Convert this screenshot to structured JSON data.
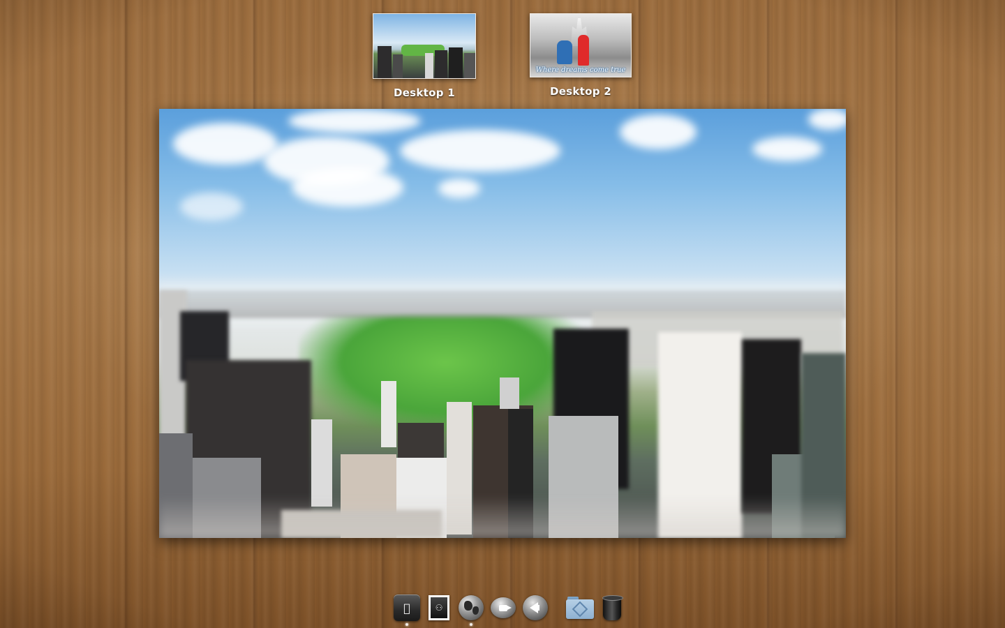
{
  "spaces": [
    {
      "label": "Desktop 1"
    },
    {
      "label": "Desktop 2",
      "caption": "Where dreams come true"
    }
  ],
  "preview": {
    "wallpaper": "city-park-tilt-shift"
  },
  "dock": {
    "items": [
      {
        "icon": "apple-icon",
        "running": true
      },
      {
        "icon": "photo-stamp-icon",
        "running": false
      },
      {
        "icon": "globe-icon",
        "running": true
      },
      {
        "icon": "facetime-icon",
        "running": false
      },
      {
        "icon": "speaker-icon",
        "running": false
      },
      {
        "icon": "folder-icon",
        "running": false
      },
      {
        "icon": "trash-icon",
        "running": false
      }
    ]
  },
  "colors": {
    "wood": "#a87a4a",
    "label": "#ffffff",
    "sky": "#5b9fdc",
    "park": "#4aa53a"
  }
}
